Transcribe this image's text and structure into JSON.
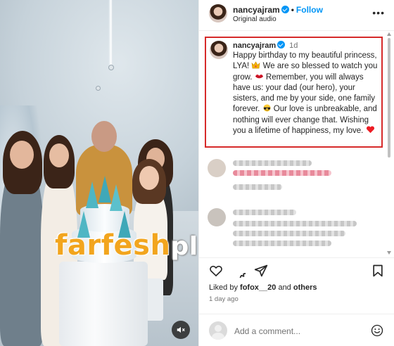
{
  "header": {
    "username": "nancyajram",
    "separator": "•",
    "follow_label": "Follow",
    "audio_label": "Original audio",
    "more_label": "•••"
  },
  "caption": {
    "username": "nancyajram",
    "time": "1d",
    "text_parts": [
      "Happy birthday to my beautiful princess, LYA! ",
      " We are so blessed to watch you grow. ",
      " Remember, you will always have us: your dad (our hero), your sisters, and me by your side, one family forever. ",
      " Our love is unbreakable, and nothing will ever change that. Wishing you a lifetime of happiness, my love. "
    ],
    "emojis": [
      "crown-emoji",
      "lips-emoji",
      "sunglasses-emoji",
      "heart-emoji"
    ]
  },
  "watermark": {
    "brand": "farfesh",
    "suffix": "plus.com"
  },
  "likes": {
    "prefix": "Liked by ",
    "user": "fofox__20",
    "joiner": " and ",
    "others": "others"
  },
  "post_age": "1 day ago",
  "add_comment": {
    "placeholder": "Add a comment..."
  },
  "colors": {
    "accent": "#0095f6",
    "highlight_border": "#d62a2a",
    "watermark": "#f2a51e",
    "heart": "#ed1c24"
  },
  "icons": [
    "heart-icon",
    "comment-icon",
    "share-icon",
    "bookmark-icon",
    "emoji-icon",
    "mute-icon",
    "verified-badge-icon"
  ]
}
